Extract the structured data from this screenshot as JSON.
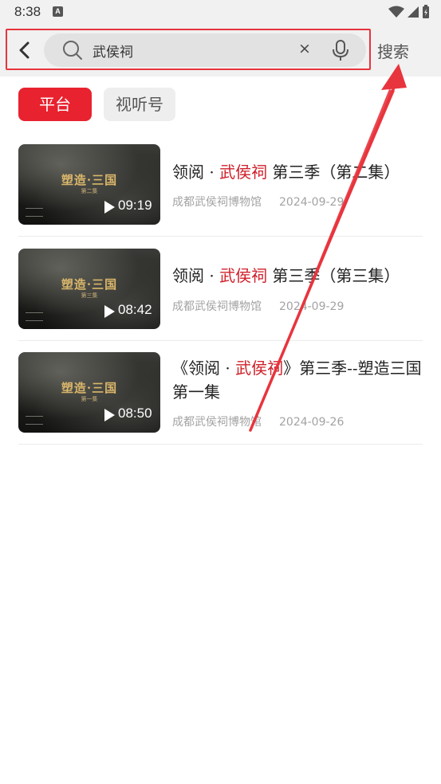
{
  "status_bar": {
    "time": "8:38",
    "notif_letter": "A"
  },
  "search": {
    "query": "武侯祠",
    "clear": "×",
    "button": "搜索"
  },
  "tabs": [
    {
      "label": "平台",
      "active": true
    },
    {
      "label": "视听号",
      "active": false
    }
  ],
  "results": [
    {
      "thumb_title": "塑造·三国",
      "thumb_sub": "第二集",
      "duration": "09:19",
      "title_pre": "领阅 · ",
      "title_hl": "武侯祠",
      "title_post": " 第三季（第二集）",
      "source": "成都武侯祠博物馆",
      "date": "2024-09-29"
    },
    {
      "thumb_title": "塑造·三国",
      "thumb_sub": "第三集",
      "duration": "08:42",
      "title_pre": "领阅 · ",
      "title_hl": "武侯祠",
      "title_post": " 第三季（第三集）",
      "source": "成都武侯祠博物馆",
      "date": "2024-09-29"
    },
    {
      "thumb_title": "塑造·三国",
      "thumb_sub": "第一集",
      "duration": "08:50",
      "title_pre": "《领阅 · ",
      "title_hl": "武侯祠",
      "title_post": "》第三季--塑造三国 第一集",
      "source": "成都武侯祠博物馆",
      "date": "2024-09-26"
    }
  ],
  "colors": {
    "accent": "#e8222f",
    "highlight": "#d0202a",
    "annotation": "#e8343d"
  }
}
